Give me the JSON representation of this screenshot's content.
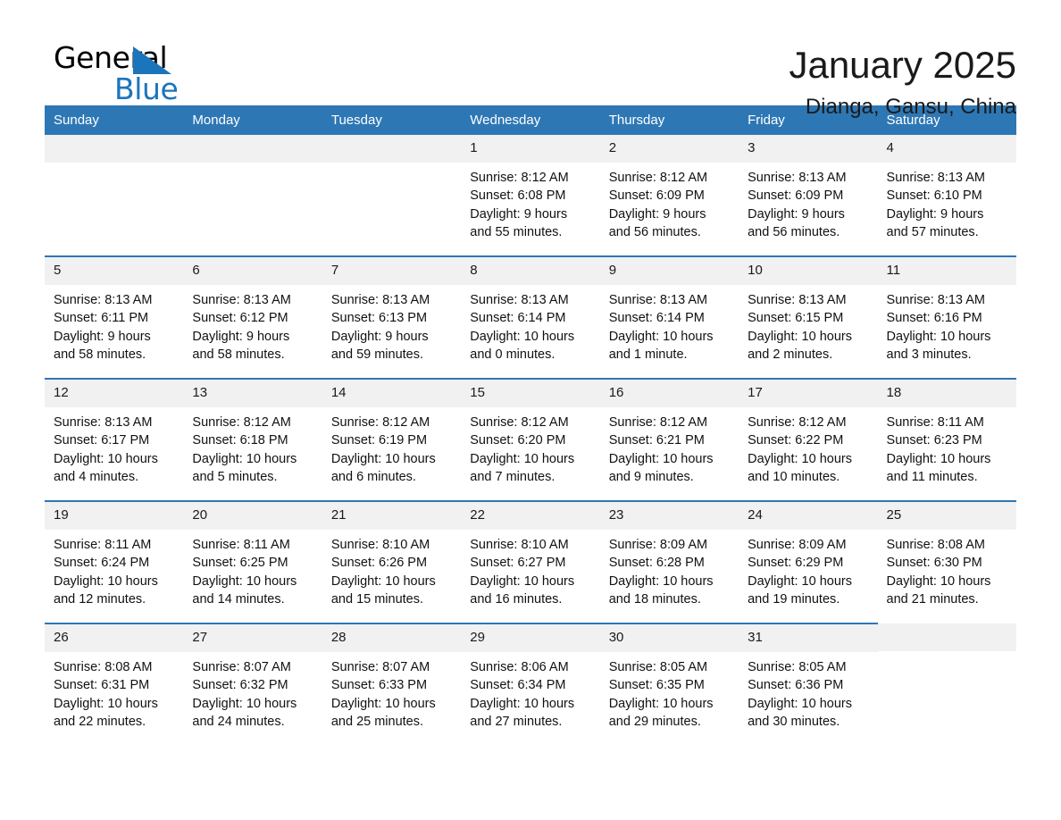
{
  "logo": {
    "word1": "General",
    "word2": "Blue",
    "triangle_color": "#1B75BB"
  },
  "header": {
    "title": "January 2025",
    "location": "Dianga, Gansu, China"
  },
  "colors": {
    "header_blue": "#2E77B5",
    "daynum_gray": "#F1F1F1",
    "text": "#111111"
  },
  "weekdays": [
    "Sunday",
    "Monday",
    "Tuesday",
    "Wednesday",
    "Thursday",
    "Friday",
    "Saturday"
  ],
  "weeks": [
    [
      {
        "day": "",
        "empty": true
      },
      {
        "day": "",
        "empty": true
      },
      {
        "day": "",
        "empty": true
      },
      {
        "day": "1",
        "sunrise": "Sunrise: 8:12 AM",
        "sunset": "Sunset: 6:08 PM",
        "daylight_1": "Daylight: 9 hours",
        "daylight_2": "and 55 minutes."
      },
      {
        "day": "2",
        "sunrise": "Sunrise: 8:12 AM",
        "sunset": "Sunset: 6:09 PM",
        "daylight_1": "Daylight: 9 hours",
        "daylight_2": "and 56 minutes."
      },
      {
        "day": "3",
        "sunrise": "Sunrise: 8:13 AM",
        "sunset": "Sunset: 6:09 PM",
        "daylight_1": "Daylight: 9 hours",
        "daylight_2": "and 56 minutes."
      },
      {
        "day": "4",
        "sunrise": "Sunrise: 8:13 AM",
        "sunset": "Sunset: 6:10 PM",
        "daylight_1": "Daylight: 9 hours",
        "daylight_2": "and 57 minutes."
      }
    ],
    [
      {
        "day": "5",
        "sunrise": "Sunrise: 8:13 AM",
        "sunset": "Sunset: 6:11 PM",
        "daylight_1": "Daylight: 9 hours",
        "daylight_2": "and 58 minutes."
      },
      {
        "day": "6",
        "sunrise": "Sunrise: 8:13 AM",
        "sunset": "Sunset: 6:12 PM",
        "daylight_1": "Daylight: 9 hours",
        "daylight_2": "and 58 minutes."
      },
      {
        "day": "7",
        "sunrise": "Sunrise: 8:13 AM",
        "sunset": "Sunset: 6:13 PM",
        "daylight_1": "Daylight: 9 hours",
        "daylight_2": "and 59 minutes."
      },
      {
        "day": "8",
        "sunrise": "Sunrise: 8:13 AM",
        "sunset": "Sunset: 6:14 PM",
        "daylight_1": "Daylight: 10 hours",
        "daylight_2": "and 0 minutes."
      },
      {
        "day": "9",
        "sunrise": "Sunrise: 8:13 AM",
        "sunset": "Sunset: 6:14 PM",
        "daylight_1": "Daylight: 10 hours",
        "daylight_2": "and 1 minute."
      },
      {
        "day": "10",
        "sunrise": "Sunrise: 8:13 AM",
        "sunset": "Sunset: 6:15 PM",
        "daylight_1": "Daylight: 10 hours",
        "daylight_2": "and 2 minutes."
      },
      {
        "day": "11",
        "sunrise": "Sunrise: 8:13 AM",
        "sunset": "Sunset: 6:16 PM",
        "daylight_1": "Daylight: 10 hours",
        "daylight_2": "and 3 minutes."
      }
    ],
    [
      {
        "day": "12",
        "sunrise": "Sunrise: 8:13 AM",
        "sunset": "Sunset: 6:17 PM",
        "daylight_1": "Daylight: 10 hours",
        "daylight_2": "and 4 minutes."
      },
      {
        "day": "13",
        "sunrise": "Sunrise: 8:12 AM",
        "sunset": "Sunset: 6:18 PM",
        "daylight_1": "Daylight: 10 hours",
        "daylight_2": "and 5 minutes."
      },
      {
        "day": "14",
        "sunrise": "Sunrise: 8:12 AM",
        "sunset": "Sunset: 6:19 PM",
        "daylight_1": "Daylight: 10 hours",
        "daylight_2": "and 6 minutes."
      },
      {
        "day": "15",
        "sunrise": "Sunrise: 8:12 AM",
        "sunset": "Sunset: 6:20 PM",
        "daylight_1": "Daylight: 10 hours",
        "daylight_2": "and 7 minutes."
      },
      {
        "day": "16",
        "sunrise": "Sunrise: 8:12 AM",
        "sunset": "Sunset: 6:21 PM",
        "daylight_1": "Daylight: 10 hours",
        "daylight_2": "and 9 minutes."
      },
      {
        "day": "17",
        "sunrise": "Sunrise: 8:12 AM",
        "sunset": "Sunset: 6:22 PM",
        "daylight_1": "Daylight: 10 hours",
        "daylight_2": "and 10 minutes."
      },
      {
        "day": "18",
        "sunrise": "Sunrise: 8:11 AM",
        "sunset": "Sunset: 6:23 PM",
        "daylight_1": "Daylight: 10 hours",
        "daylight_2": "and 11 minutes."
      }
    ],
    [
      {
        "day": "19",
        "sunrise": "Sunrise: 8:11 AM",
        "sunset": "Sunset: 6:24 PM",
        "daylight_1": "Daylight: 10 hours",
        "daylight_2": "and 12 minutes."
      },
      {
        "day": "20",
        "sunrise": "Sunrise: 8:11 AM",
        "sunset": "Sunset: 6:25 PM",
        "daylight_1": "Daylight: 10 hours",
        "daylight_2": "and 14 minutes."
      },
      {
        "day": "21",
        "sunrise": "Sunrise: 8:10 AM",
        "sunset": "Sunset: 6:26 PM",
        "daylight_1": "Daylight: 10 hours",
        "daylight_2": "and 15 minutes."
      },
      {
        "day": "22",
        "sunrise": "Sunrise: 8:10 AM",
        "sunset": "Sunset: 6:27 PM",
        "daylight_1": "Daylight: 10 hours",
        "daylight_2": "and 16 minutes."
      },
      {
        "day": "23",
        "sunrise": "Sunrise: 8:09 AM",
        "sunset": "Sunset: 6:28 PM",
        "daylight_1": "Daylight: 10 hours",
        "daylight_2": "and 18 minutes."
      },
      {
        "day": "24",
        "sunrise": "Sunrise: 8:09 AM",
        "sunset": "Sunset: 6:29 PM",
        "daylight_1": "Daylight: 10 hours",
        "daylight_2": "and 19 minutes."
      },
      {
        "day": "25",
        "sunrise": "Sunrise: 8:08 AM",
        "sunset": "Sunset: 6:30 PM",
        "daylight_1": "Daylight: 10 hours",
        "daylight_2": "and 21 minutes."
      }
    ],
    [
      {
        "day": "26",
        "sunrise": "Sunrise: 8:08 AM",
        "sunset": "Sunset: 6:31 PM",
        "daylight_1": "Daylight: 10 hours",
        "daylight_2": "and 22 minutes."
      },
      {
        "day": "27",
        "sunrise": "Sunrise: 8:07 AM",
        "sunset": "Sunset: 6:32 PM",
        "daylight_1": "Daylight: 10 hours",
        "daylight_2": "and 24 minutes."
      },
      {
        "day": "28",
        "sunrise": "Sunrise: 8:07 AM",
        "sunset": "Sunset: 6:33 PM",
        "daylight_1": "Daylight: 10 hours",
        "daylight_2": "and 25 minutes."
      },
      {
        "day": "29",
        "sunrise": "Sunrise: 8:06 AM",
        "sunset": "Sunset: 6:34 PM",
        "daylight_1": "Daylight: 10 hours",
        "daylight_2": "and 27 minutes."
      },
      {
        "day": "30",
        "sunrise": "Sunrise: 8:05 AM",
        "sunset": "Sunset: 6:35 PM",
        "daylight_1": "Daylight: 10 hours",
        "daylight_2": "and 29 minutes."
      },
      {
        "day": "31",
        "sunrise": "Sunrise: 8:05 AM",
        "sunset": "Sunset: 6:36 PM",
        "daylight_1": "Daylight: 10 hours",
        "daylight_2": "and 30 minutes."
      },
      {
        "day": "",
        "empty": true
      }
    ]
  ]
}
